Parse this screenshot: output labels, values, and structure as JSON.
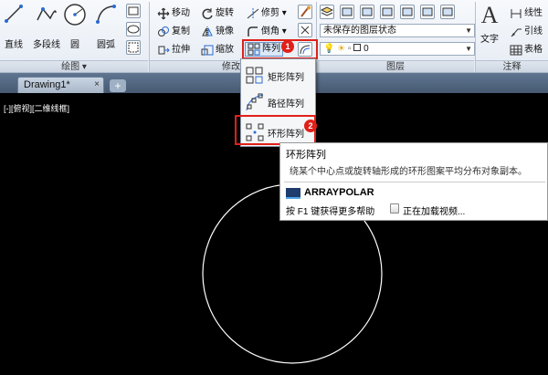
{
  "ribbon": {
    "draw": {
      "line": "直线",
      "polyline": "多段线",
      "circle": "圆",
      "arc": "圆弧",
      "panel": "绘图 ▾"
    },
    "modify": {
      "move": "移动",
      "rotate": "旋转",
      "trim": "修剪 ▾",
      "copy": "复制",
      "mirror": "镜像",
      "fillet": "倒角 ▾",
      "stretch": "拉伸",
      "scale": "缩放",
      "array": "阵列",
      "panel": "修改"
    },
    "layers": {
      "state": "未保存的图层状态",
      "layer_value": "0",
      "panel": "图层"
    },
    "annotation": {
      "text": "文字",
      "linear": "线性",
      "leader": "引线",
      "table": "表格",
      "panel": "注释"
    }
  },
  "badges": {
    "one": "1",
    "two": "2"
  },
  "tabs": {
    "doc": "Drawing1*",
    "new_tab": "+"
  },
  "viewport": {
    "label": "[-][俯视][二维线框]"
  },
  "menu": {
    "items": [
      {
        "label": "矩形阵列"
      },
      {
        "label": "路径阵列"
      },
      {
        "label": "环形阵列"
      }
    ]
  },
  "tooltip": {
    "title": "环形阵列",
    "description": "绕某个中心点或旋转轴形成的环形图案平均分布对象副本。",
    "command": "ARRAYPOLAR",
    "help": "按 F1 键获得更多帮助",
    "video": "正在加载视频..."
  },
  "colors": {
    "highlight": "#e0201a",
    "canvas": "#000000",
    "circle": "#ffffff"
  }
}
